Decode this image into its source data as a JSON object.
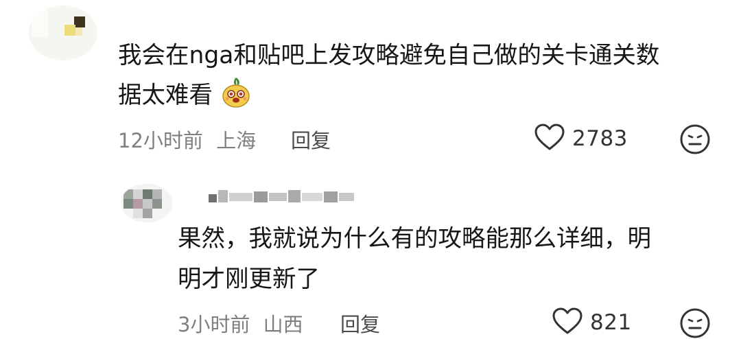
{
  "main_comment": {
    "line1": "我会在nga和贴吧上发攻略避免自己做的关卡通关数",
    "line2": "据太难看",
    "emoji": "melon-face-emoji",
    "time": "12小时前",
    "location": "上海",
    "reply_label": "回复",
    "likes": "2783"
  },
  "reply_comment": {
    "line1": "果然，我就说为什么有的攻略能那么详细，明",
    "line2": "明才刚更新了",
    "time": "3小时前",
    "location": "山西",
    "reply_label": "回复",
    "likes": "821"
  },
  "icons": {
    "like": "heart-outline-icon",
    "dislike": "neutral-face-icon"
  },
  "colors": {
    "text": "#161616",
    "meta": "#7f7f7f",
    "icon_stroke": "#333333"
  }
}
